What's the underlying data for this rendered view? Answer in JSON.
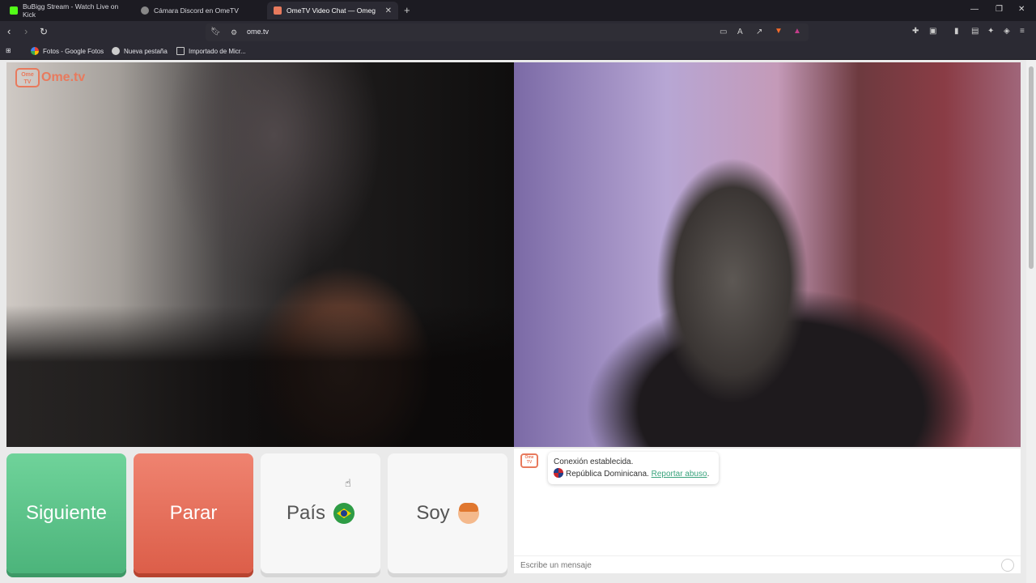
{
  "tabs": [
    {
      "label": "BuBigg Stream - Watch Live on Kick",
      "favicon_color": "#53fc18"
    },
    {
      "label": "Cámara Discord en OmeTV",
      "favicon_color": "#bbbbbb"
    },
    {
      "label": "OmeTV Video Chat — Omeg",
      "favicon_color": "#e87a5d",
      "active": true
    }
  ],
  "address": {
    "url": "ome.tv"
  },
  "bookmarks": [
    {
      "label": "Fotos - Google Fotos"
    },
    {
      "label": "Nueva pestaña"
    },
    {
      "label": "Importado de Micr..."
    }
  ],
  "logo": {
    "badge": "Ome TV",
    "text": "Ome.tv"
  },
  "controls": {
    "next_label": "Siguiente",
    "stop_label": "Parar",
    "country_label": "País",
    "gender_label": "Soy"
  },
  "chat": {
    "avatar_text": "Ome TV",
    "status_line": "Conexión establecida.",
    "country_name": "República Dominicana.",
    "report_link": "Reportar abuso",
    "report_suffix": ".",
    "input_placeholder": "Escribe un mensaje"
  },
  "colors": {
    "next_button": "#5cc48a",
    "stop_button": "#e56d57",
    "brand": "#e87a5d",
    "link": "#3aa37d"
  }
}
